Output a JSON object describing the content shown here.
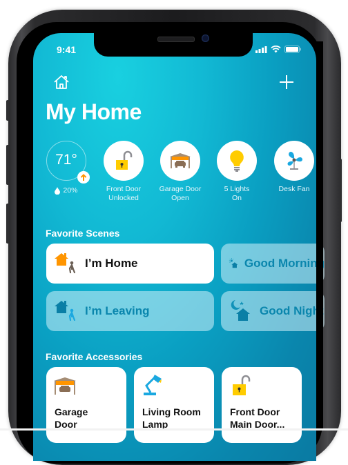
{
  "status_bar": {
    "time": "9:41"
  },
  "header": {
    "title": "My Home",
    "home_icon": "house-icon",
    "add_icon": "plus-icon"
  },
  "climate": {
    "temperature": "71°",
    "humidity": "20%",
    "trend_icon": "arrow-up-icon"
  },
  "status_tiles": [
    {
      "line1": "Front Door",
      "line2": "Unlocked",
      "icon": "unlocked-padlock-icon"
    },
    {
      "line1": "Garage Door",
      "line2": "Open",
      "icon": "garage-open-icon"
    },
    {
      "line1": "5 Lights",
      "line2": "On",
      "icon": "lightbulb-icon"
    },
    {
      "line1": "Desk Fan",
      "line2": "",
      "icon": "fan-icon"
    }
  ],
  "favorite_scenes": {
    "heading": "Favorite Scenes",
    "items": [
      {
        "label": "I’m Home",
        "active": true,
        "icon": "arrive-home-icon"
      },
      {
        "label": "Good Morning",
        "active": false,
        "icon": "good-morning-icon"
      },
      {
        "label": "I’m Leaving",
        "active": false,
        "icon": "leave-home-icon"
      },
      {
        "label": "Good Night",
        "active": false,
        "icon": "good-night-icon"
      }
    ]
  },
  "favorite_accessories": {
    "heading": "Favorite Accessories",
    "items": [
      {
        "line1": "Garage",
        "line2": "Door",
        "icon": "garage-open-icon"
      },
      {
        "line1": "Living Room",
        "line2": "Lamp",
        "icon": "desk-lamp-icon"
      },
      {
        "line1": "Front Door",
        "line2": "Main Door...",
        "icon": "unlocked-padlock-icon"
      }
    ]
  },
  "colors": {
    "accent_orange": "#ff9500",
    "lock_yellow": "#ffcc00",
    "scene_blue": "#0a7fa6",
    "fan_blue": "#1aa8e0"
  }
}
